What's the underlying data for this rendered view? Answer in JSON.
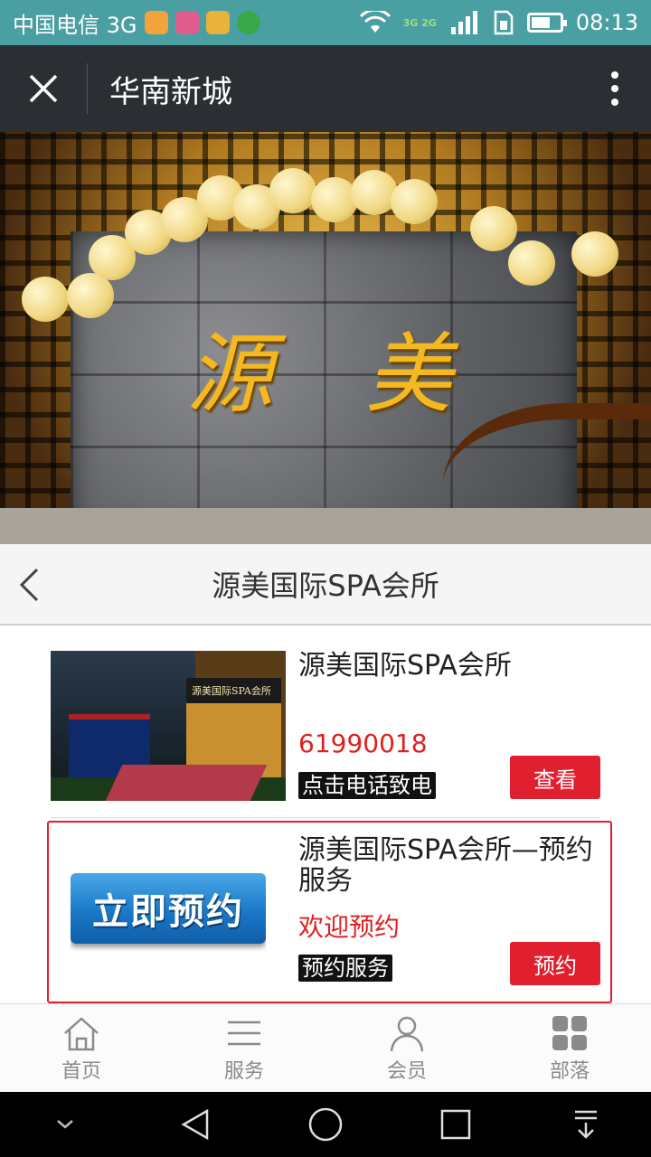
{
  "status_bar": {
    "carrier": "中国电信 3G",
    "network_badge": "3G 2G",
    "time": "08:13",
    "app_icon_colors": [
      "#f2a33a",
      "#e05c8a",
      "#e9b23a",
      "#39a84a"
    ],
    "battery_level": 0.6
  },
  "title_bar": {
    "title": "华南新城",
    "close_icon": "close-icon",
    "more_icon": "more-vertical-icon"
  },
  "hero": {
    "sign_chars": [
      "源",
      "美"
    ]
  },
  "subheader": {
    "title": "源美国际SPA会所"
  },
  "items": [
    {
      "name": "源美国际SPA会所",
      "subtitle": "61990018",
      "tag": "点击电话致电",
      "button": "查看",
      "storefront_text": "源美国际SPA会所"
    },
    {
      "name": "源美国际SPA会所—预约服务",
      "subtitle": "欢迎预约",
      "tag": "预约服务",
      "button": "预约",
      "thumb_text": "立即预约"
    }
  ],
  "tabs": [
    {
      "label": "首页",
      "icon": "home-icon"
    },
    {
      "label": "服务",
      "icon": "menu-list-icon"
    },
    {
      "label": "会员",
      "icon": "user-icon"
    },
    {
      "label": "部落",
      "icon": "grid-icon"
    }
  ],
  "colors": {
    "status_bar": "#4a9fa3",
    "title_bar": "#2b2f33",
    "accent_red": "#e0202f",
    "tab_gray": "#8a8a8a"
  }
}
